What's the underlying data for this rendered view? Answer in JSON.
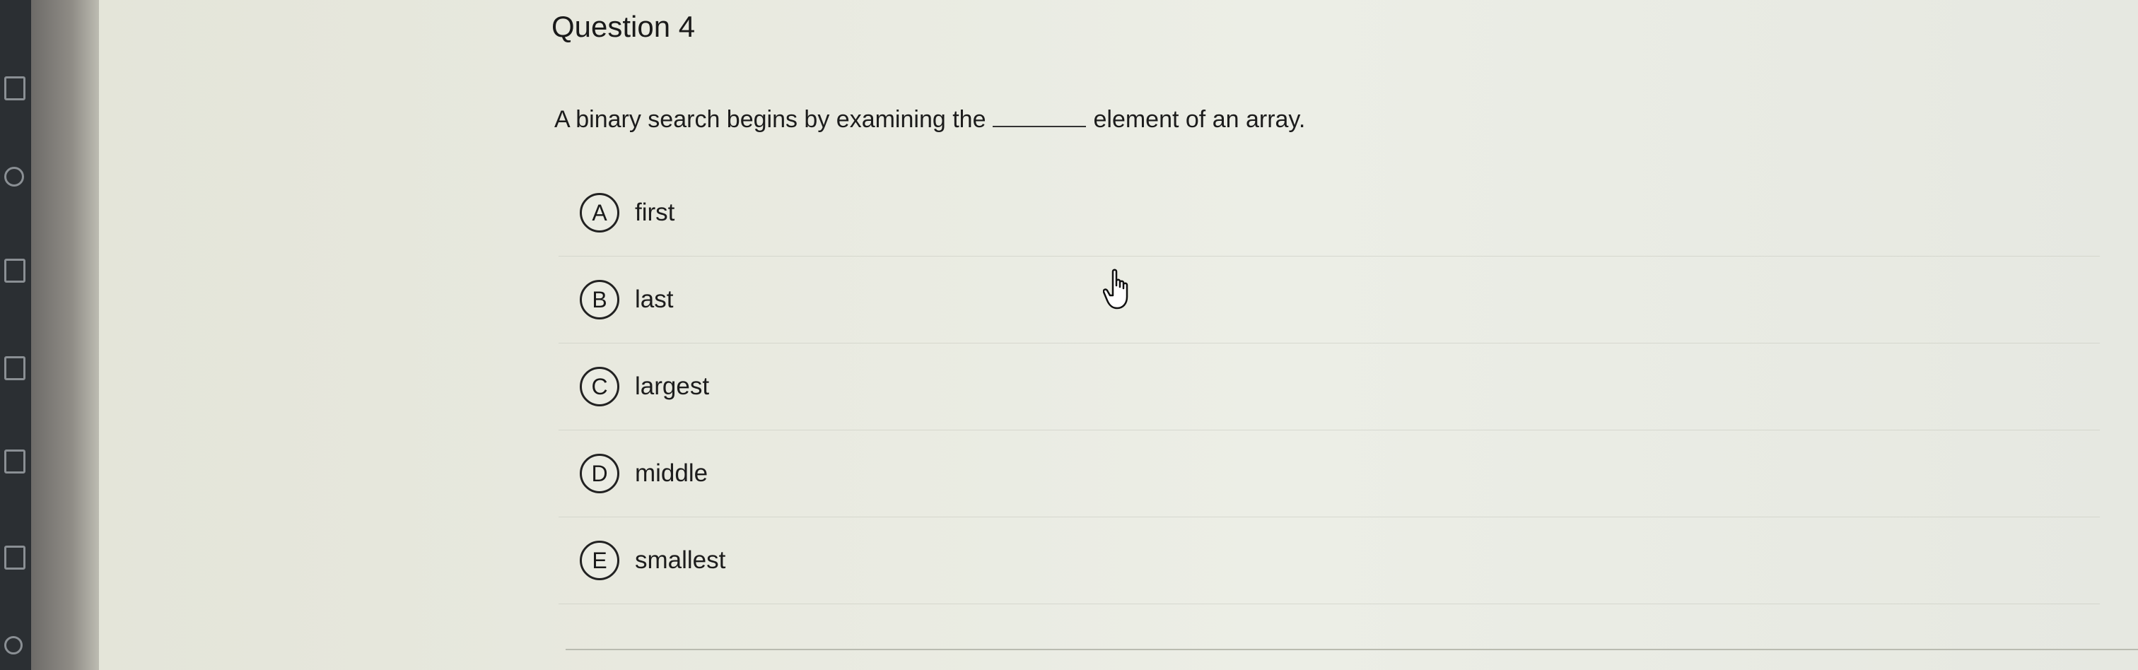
{
  "question": {
    "title": "Question 4",
    "prompt_before": "A binary search begins by examining the",
    "prompt_after": "element of an array."
  },
  "options": [
    {
      "letter": "A",
      "label": "first"
    },
    {
      "letter": "B",
      "label": "last"
    },
    {
      "letter": "C",
      "label": "largest"
    },
    {
      "letter": "D",
      "label": "middle"
    },
    {
      "letter": "E",
      "label": "smallest"
    }
  ],
  "sidebar": {
    "icons": [
      "grades-icon",
      "user-icon",
      "calendar-icon",
      "inbox-icon",
      "history-icon",
      "external-link-icon",
      "back-icon"
    ]
  },
  "cursor": {
    "icon": "hand-pointer-icon"
  }
}
